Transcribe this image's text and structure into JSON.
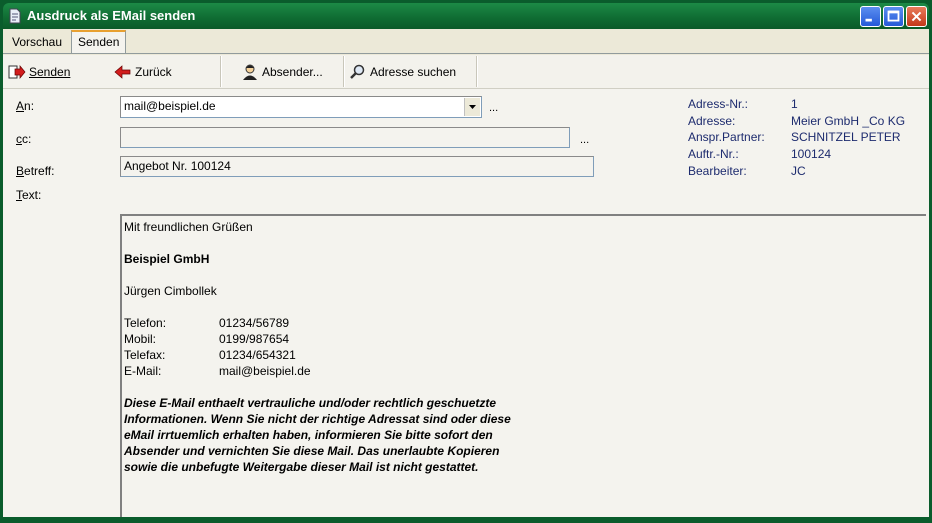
{
  "window": {
    "title": "Ausdruck als EMail senden",
    "buttons": [
      "minimize-icon",
      "maximize-icon",
      "close-icon"
    ]
  },
  "tabs": [
    {
      "label": "Vorschau",
      "active": false
    },
    {
      "label": "Senden",
      "active": true
    }
  ],
  "toolbar": {
    "send_label": "Senden",
    "back_label": "Zurück",
    "sender_label": "Absender...",
    "search_label": "Adresse suchen"
  },
  "form": {
    "to_label": "An:",
    "to_value": "mail@beispiel.de",
    "cc_label": "cc:",
    "cc_value": "",
    "subject_label": "Betreff:",
    "subject_value": "Angebot Nr. 100124",
    "text_label": "Text:",
    "ellipsis": "..."
  },
  "info": {
    "labels": [
      "Adress-Nr.:",
      "Adresse:",
      "Anspr.Partner:",
      "Auftr.-Nr.:",
      "Bearbeiter:"
    ],
    "values": [
      "1",
      "Meier GmbH _Co KG",
      "SCHNITZEL PETER",
      "100124",
      "JC"
    ]
  },
  "body": {
    "greeting": "Mit freundlichen Grüßen",
    "company": "Beispiel GmbH",
    "name": "Jürgen Cimbollek",
    "contacts": [
      {
        "label": "Telefon:",
        "value": "01234/56789"
      },
      {
        "label": "Mobil:",
        "value": "0199/987654"
      },
      {
        "label": "Telefax:",
        "value": "01234/654321"
      },
      {
        "label": "E-Mail:",
        "value": "mail@beispiel.de"
      }
    ],
    "disclaimer": [
      "Diese E-Mail enthaelt vertrauliche und/oder rechtlich geschuetzte",
      "Informationen. Wenn Sie nicht der richtige Adressat sind oder diese",
      "eMail irrtuemlich erhalten haben, informieren Sie bitte sofort den",
      "Absender und vernichten Sie diese Mail. Das unerlaubte Kopieren",
      "sowie die unbefugte Weitergabe dieser Mail ist nicht gestattet."
    ]
  },
  "colors": {
    "titlebar": "#0f6b32",
    "info_text": "#1d2b6e",
    "client_bg": "#ece9d8"
  }
}
